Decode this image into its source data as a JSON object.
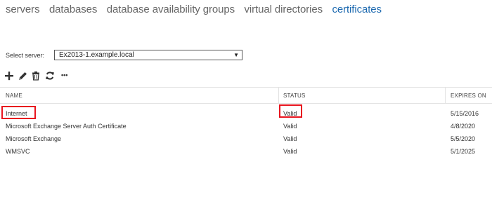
{
  "nav": {
    "tabs": [
      {
        "label": "servers"
      },
      {
        "label": "databases"
      },
      {
        "label": "database availability groups"
      },
      {
        "label": "virtual directories"
      },
      {
        "label": "certificates"
      }
    ],
    "active_tab": "certificates"
  },
  "server_picker": {
    "label": "Select server:",
    "value": "Ex2013-1.example.local",
    "arrow": "▼"
  },
  "toolbar": {
    "icons": [
      "add-icon",
      "edit-icon",
      "delete-icon",
      "refresh-icon",
      "more-icon"
    ],
    "more_glyph": "•••"
  },
  "table": {
    "columns": [
      "NAME",
      "STATUS",
      "EXPIRES ON"
    ],
    "rows": [
      {
        "name": "Internet",
        "status": "Valid",
        "expires": "5/15/2016"
      },
      {
        "name": "Microsoft Exchange Server Auth Certificate",
        "status": "Valid",
        "expires": "4/8/2020"
      },
      {
        "name": "Microsoft Exchange",
        "status": "Valid",
        "expires": "5/5/2020"
      },
      {
        "name": "WMSVC",
        "status": "Valid",
        "expires": "5/1/2025"
      }
    ]
  },
  "highlight_color": "#e8141e",
  "accent_color": "#1e6ab0"
}
